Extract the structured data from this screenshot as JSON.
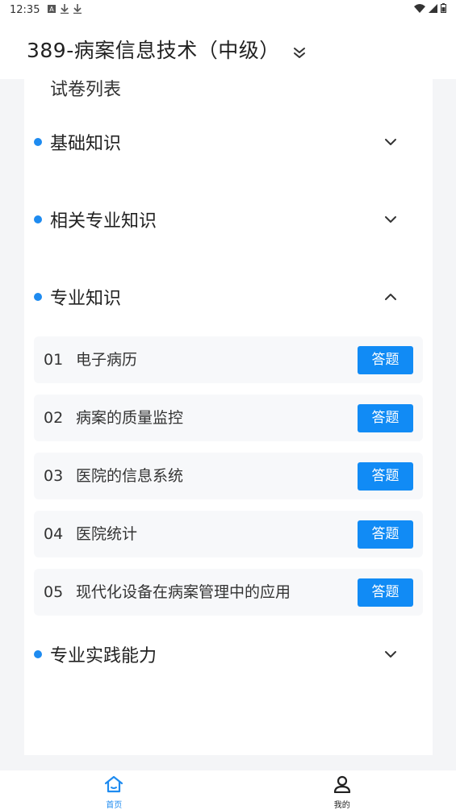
{
  "status_bar": {
    "time": "12:35",
    "icons": [
      "notification-a-icon",
      "download-icon",
      "download-icon",
      "wifi-icon",
      "signal-icon",
      "battery-icon"
    ]
  },
  "header": {
    "title": "389-病案信息技术（中级）",
    "dropdown_icon": "double-chevron-down-icon"
  },
  "list_title": "试卷列表",
  "accent_color": "#1e8bf0",
  "button_color": "#118bf5",
  "sections": [
    {
      "label": "基础知识",
      "expanded": false
    },
    {
      "label": "相关专业知识",
      "expanded": false
    },
    {
      "label": "专业知识",
      "expanded": true
    },
    {
      "label": "专业实践能力",
      "expanded": false
    }
  ],
  "items": [
    {
      "num": "01",
      "name": "电子病历",
      "button": "答题"
    },
    {
      "num": "02",
      "name": "病案的质量监控",
      "button": "答题"
    },
    {
      "num": "03",
      "name": "医院的信息系统",
      "button": "答题"
    },
    {
      "num": "04",
      "name": "医院统计",
      "button": "答题"
    },
    {
      "num": "05",
      "name": "现代化设备在病案管理中的应用",
      "button": "答题"
    }
  ],
  "bottom_nav": [
    {
      "label": "首页",
      "icon": "home-icon",
      "active": true
    },
    {
      "label": "我的",
      "icon": "user-icon",
      "active": false
    }
  ]
}
